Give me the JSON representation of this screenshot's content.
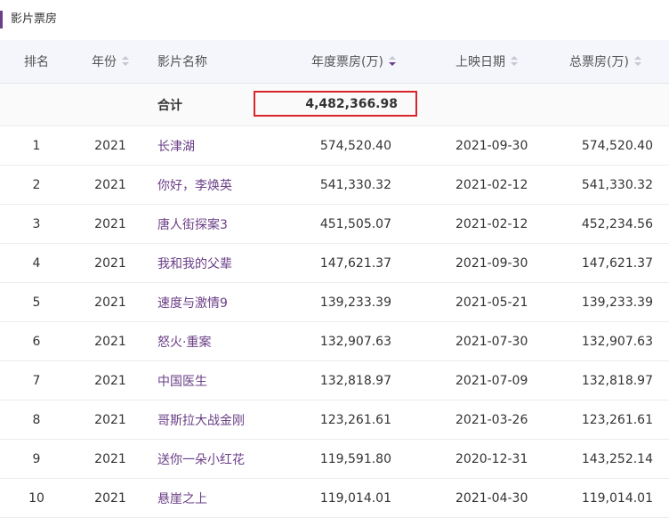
{
  "section": {
    "title": "影片票房"
  },
  "columns": {
    "rank": "排名",
    "year": "年份",
    "name": "影片名称",
    "annual": "年度票房(万)",
    "date": "上映日期",
    "total": "总票房(万)"
  },
  "total_row": {
    "label": "合计",
    "annual": "4,482,366.98"
  },
  "rows": [
    {
      "rank": "1",
      "year": "2021",
      "name": "长津湖",
      "annual": "574,520.40",
      "date": "2021-09-30",
      "total": "574,520.40"
    },
    {
      "rank": "2",
      "year": "2021",
      "name": "你好，李焕英",
      "annual": "541,330.32",
      "date": "2021-02-12",
      "total": "541,330.32"
    },
    {
      "rank": "3",
      "year": "2021",
      "name": "唐人街探案3",
      "annual": "451,505.07",
      "date": "2021-02-12",
      "total": "452,234.56"
    },
    {
      "rank": "4",
      "year": "2021",
      "name": "我和我的父辈",
      "annual": "147,621.37",
      "date": "2021-09-30",
      "total": "147,621.37"
    },
    {
      "rank": "5",
      "year": "2021",
      "name": "速度与激情9",
      "annual": "139,233.39",
      "date": "2021-05-21",
      "total": "139,233.39"
    },
    {
      "rank": "6",
      "year": "2021",
      "name": "怒火·重案",
      "annual": "132,907.63",
      "date": "2021-07-30",
      "total": "132,907.63"
    },
    {
      "rank": "7",
      "year": "2021",
      "name": "中国医生",
      "annual": "132,818.97",
      "date": "2021-07-09",
      "total": "132,818.97"
    },
    {
      "rank": "8",
      "year": "2021",
      "name": "哥斯拉大战金刚",
      "annual": "123,261.61",
      "date": "2021-03-26",
      "total": "123,261.61"
    },
    {
      "rank": "9",
      "year": "2021",
      "name": "送你一朵小红花",
      "annual": "119,591.80",
      "date": "2020-12-31",
      "total": "143,252.14"
    },
    {
      "rank": "10",
      "year": "2021",
      "name": "悬崖之上",
      "annual": "119,014.01",
      "date": "2021-04-30",
      "total": "119,014.01"
    }
  ],
  "colors": {
    "accent": "#6b3f87",
    "highlight_border": "#d9242b",
    "header_bg": "#f4f6fb"
  },
  "sort": {
    "active_column": "annual",
    "direction": "descending"
  }
}
